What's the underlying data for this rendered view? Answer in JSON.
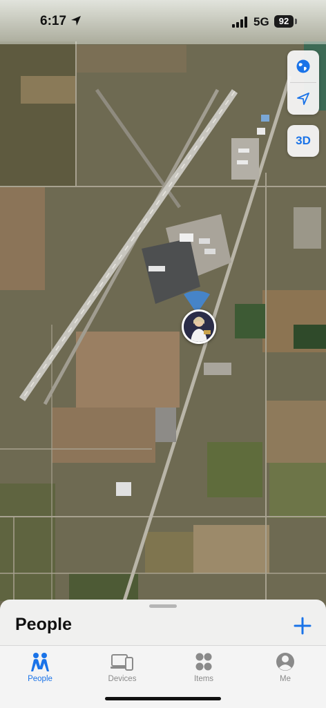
{
  "status_bar": {
    "time": "6:17",
    "network": "5G",
    "battery": "92"
  },
  "map_controls": {
    "view_3d_label": "3D"
  },
  "sheet": {
    "title": "People"
  },
  "tabs": [
    {
      "label": "People",
      "active": true
    },
    {
      "label": "Devices",
      "active": false
    },
    {
      "label": "Items",
      "active": false
    },
    {
      "label": "Me",
      "active": false
    }
  ],
  "colors": {
    "accent": "#1a73e8",
    "inactive": "#8a8a8a"
  }
}
